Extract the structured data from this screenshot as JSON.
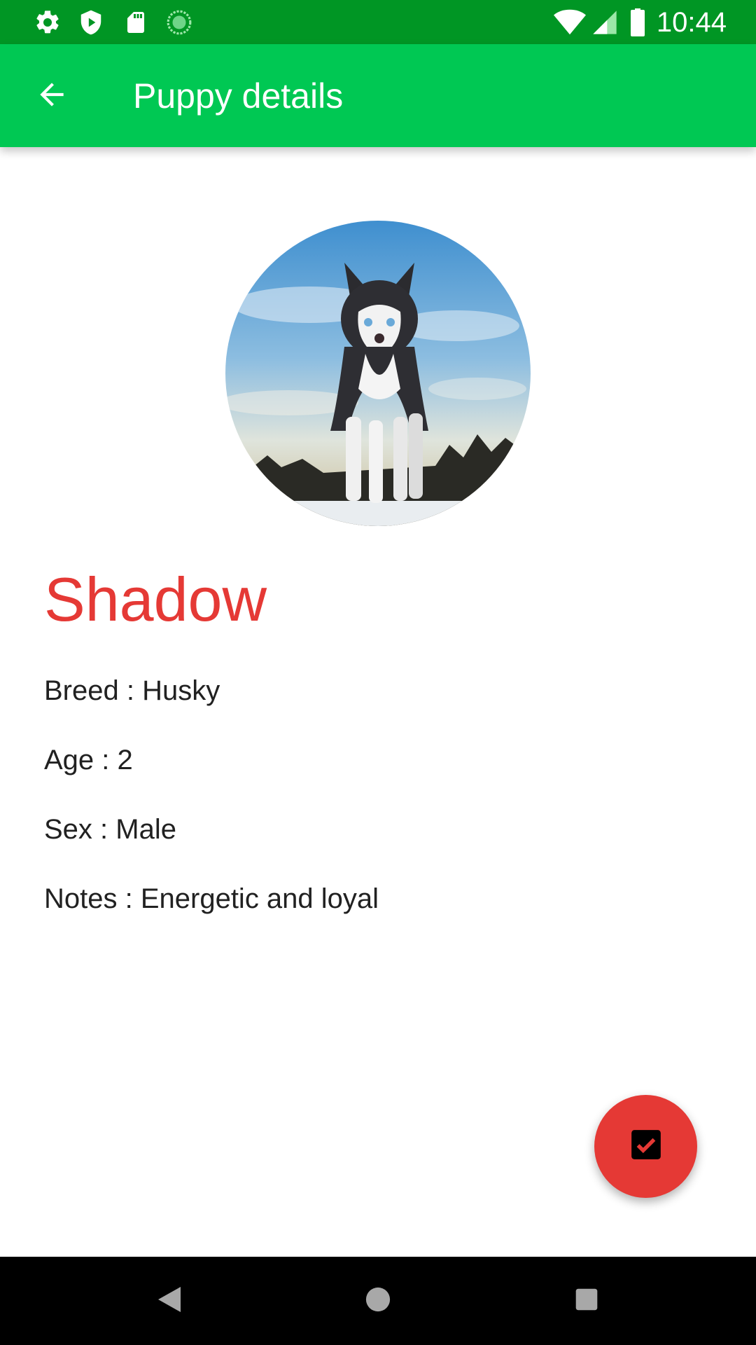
{
  "status_bar": {
    "time": "10:44",
    "left_icons": [
      "settings-icon",
      "shield-icon",
      "sd-card-icon",
      "sync-icon"
    ],
    "right_icons": [
      "wifi-icon",
      "signal-icon",
      "battery-icon"
    ]
  },
  "app_bar": {
    "title": "Puppy details",
    "back_icon": "arrow-back-icon",
    "background": "#00c853",
    "status_background": "#009624"
  },
  "puppy": {
    "name": "Shadow",
    "breed": "Breed : Husky",
    "age": "Age : 2",
    "sex": "Sex : Male",
    "notes": "Notes : Energetic and loyal",
    "name_color": "#e53935"
  },
  "fab": {
    "icon": "check-box-icon",
    "color": "#e53935"
  },
  "nav_bar": {
    "buttons": [
      "back-triangle-icon",
      "home-circle-icon",
      "recents-square-icon"
    ]
  }
}
